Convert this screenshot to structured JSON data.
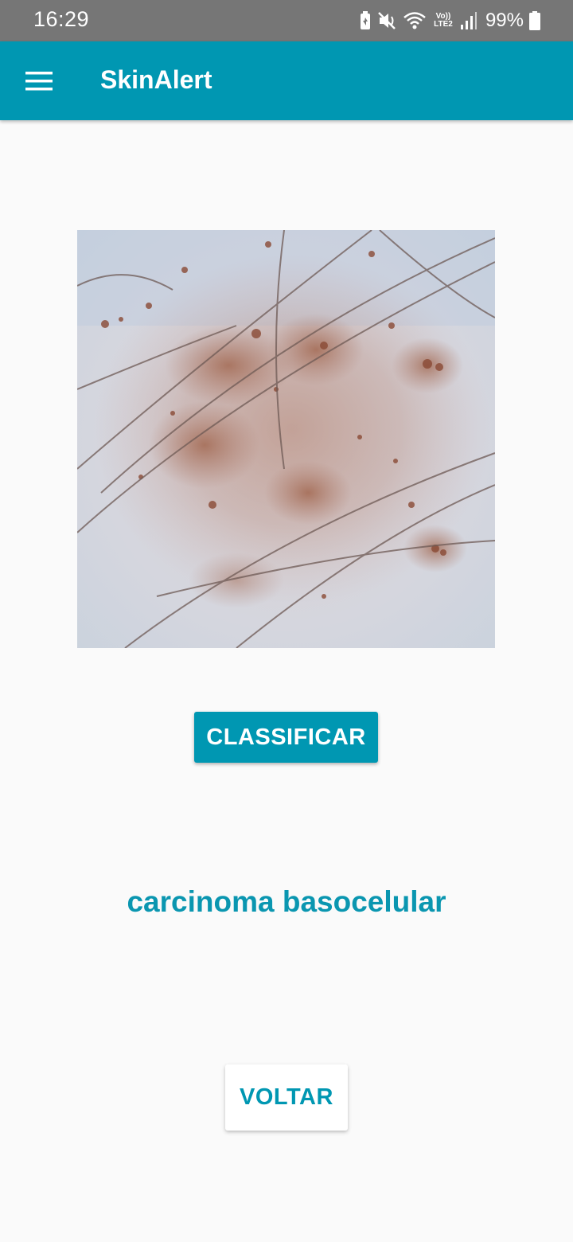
{
  "status_bar": {
    "time": "16:29",
    "lte_line1": "Vo))",
    "lte_line2": "LTE2",
    "battery_percent": "99%",
    "icons": [
      "battery-saver-icon",
      "mute-icon",
      "wifi-icon",
      "volte-icon",
      "signal-icon",
      "battery-icon"
    ]
  },
  "app_bar": {
    "menu_icon": "hamburger-menu-icon",
    "title": "SkinAlert",
    "color": "#0097b2"
  },
  "main": {
    "image_subject": "dermoscopic-skin-lesion",
    "classify_label": "CLASSIFICAR",
    "result": "carcinoma basocelular",
    "back_label": "VOLTAR"
  }
}
